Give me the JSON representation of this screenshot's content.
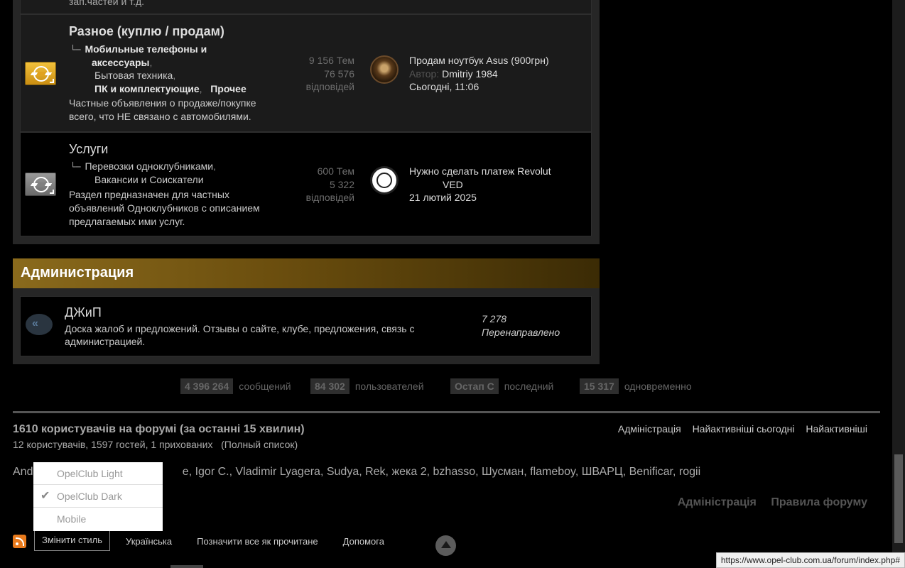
{
  "top_snippet": "зап.частей и т.д.",
  "forums": [
    {
      "title": "Разное (куплю / продам)",
      "subforums_line1_a": "Мобильные телефоны и",
      "subforums_line1_b": "аксессуары",
      "subforums_line2": "Бытовая техника",
      "subforums_line3_a": "ПК и комплектующие",
      "subforums_line3_b": "Прочее",
      "desc_1": "Частные объявления о продаже/покупке",
      "desc_2": "всего, что НЕ связано с автомобилями.",
      "topics": "9 156 Тем",
      "posts": "76 576",
      "posts_label": "відповідей",
      "last_title": "Продам ноутбук Asus (900грн)",
      "last_author_label": "Автор:",
      "last_author": "Dmitriy 1984",
      "last_time": "Сьогодні, 11:06"
    },
    {
      "title": "Услуги",
      "subforums_line1": "Перевозки одноклубниками",
      "subforums_line2": "Вакансии и Соискатели",
      "desc_1": "Раздел предназначен для частных",
      "desc_2": "объявлений Одноклубников с описанием",
      "desc_3": "предлагаемых ими услуг.",
      "topics": "600 Тем",
      "posts": "5 322",
      "posts_label": "відповідей",
      "last_title_1": "Нужно сделать платеж Revolut",
      "last_title_2": "VED",
      "last_time": "21 лютий 2025"
    }
  ],
  "admin": {
    "category_title": "Администрация",
    "forum_title": "ДЖиП",
    "desc_1": "Доска жалоб и предложений. Отзывы о сайте, клубе, предложения, связь с",
    "desc_2": "администрацией.",
    "count": "7 278",
    "redirect_label": "Перенаправлено"
  },
  "stats": [
    {
      "num": "4 396 264",
      "label": "сообщений"
    },
    {
      "num": "84 302",
      "label": "пользователей"
    },
    {
      "num": "Остап С",
      "label": "последний"
    },
    {
      "num": "15 317",
      "label": "одновременно"
    }
  ],
  "online": {
    "title": "1610 користувачів на форумі (за останні 15 хвилин)",
    "sub": "12 користувачів, 1597 гостей, 1 прихованих",
    "full_list": "(Полный список)",
    "users_prefix": "Andr",
    "users_suffix": "e, Igor C., Vladimir Lyagera, Sudya, Rek, жека 2, bzhasso, Шусман, flameboy, ШВАРЦ, Benificar, rogii"
  },
  "toplinks": [
    "Адміністрація",
    "Найактивніші сьогодні",
    "Найактивніші"
  ],
  "bottomlinks": [
    "Адміністрація",
    "Правила форуму"
  ],
  "footer": {
    "change_style": "Змінити стиль",
    "language": "Українська",
    "mark_read": "Позначити все як прочитане",
    "help": "Допомога"
  },
  "style_menu": [
    "OpelClub Light",
    "OpelClub Dark",
    "Mobile"
  ],
  "status_url": "https://www.opel-club.com.ua/forum/index.php#"
}
